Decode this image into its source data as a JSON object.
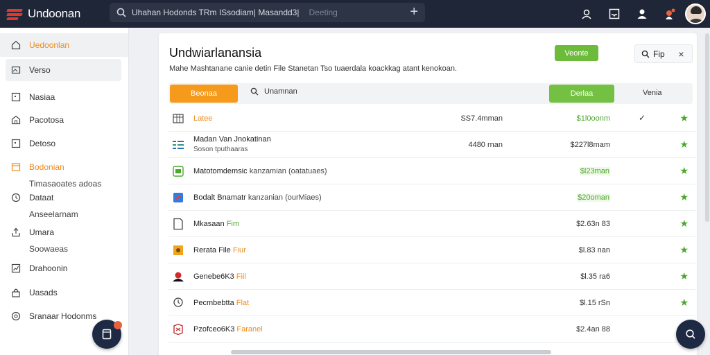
{
  "app": {
    "name": "Undoonan"
  },
  "search": {
    "text": "Uhahan Hodonds TRm ISsodiam| Masandd3| ",
    "placeholder": "Deeting"
  },
  "topbar_icons": [
    "user-icon",
    "inbox-icon",
    "account-icon",
    "notification-icon",
    "avatar"
  ],
  "sidebar": {
    "items": [
      {
        "label": "Uedoonlan",
        "icon": "home-icon",
        "state": "active"
      },
      {
        "label": "Verso",
        "icon": "image-icon",
        "state": "highlight"
      },
      {
        "label": "Nasiaa",
        "icon": "square-icon"
      },
      {
        "label": "Pacotosa",
        "icon": "house-icon"
      },
      {
        "label": "Detoso",
        "icon": "square-icon"
      },
      {
        "label": "Bodonian",
        "sub": "Timasaoates adoas",
        "icon": "folder-icon",
        "state": "orange"
      },
      {
        "label": "Dataat",
        "sub": "Anseelarnam",
        "icon": "clock-icon"
      },
      {
        "label": "Umara",
        "sub": "Soowaeas",
        "icon": "export-icon"
      },
      {
        "label": "Drahoonin",
        "icon": "chart-icon"
      },
      {
        "label": "Uasads",
        "icon": "lock-icon"
      },
      {
        "label": "Sranaar Hodonms",
        "icon": "settings-icon"
      }
    ]
  },
  "panel": {
    "title": "Undwiarlanansia",
    "description": "Mahe Mashtanane canie detin File  Stanetan Tso tuaerdala koackkag atant kenokoan.",
    "green_button": "Veonte",
    "flip_button": "Fip",
    "close_symbol": "×"
  },
  "toolbar": {
    "orange_button": "Beonaa",
    "search_label": "Unamnan",
    "green_button": "Derlaa",
    "view_label": "Venia"
  },
  "colors": {
    "orange": "#f59a1b",
    "green": "#6cbb3a",
    "navy": "#1f2637"
  },
  "rows": [
    {
      "icon": "grid-icon",
      "name": "Latee",
      "name_style": "orange",
      "size": "SS7.4mman",
      "price": "$1l0oonm",
      "price_style": "green",
      "check": "✓",
      "star": "★"
    },
    {
      "icon": "table-icon",
      "name": "Madan Van Jnokatinan",
      "sub": "Soson tputhaaras",
      "size": "4480 rnan",
      "price": "$227l8mam",
      "price_style": "plain",
      "star": "★"
    },
    {
      "icon": "spreadsheet-icon",
      "name": "Matotomdemsic",
      "muted": "kanzamian (oatatuaes)",
      "price": "$l23man",
      "price_style": "green-bg",
      "star": "★"
    },
    {
      "icon": "doc-icon",
      "name": "Bodalt Bnamatr",
      "muted": "kanzanian (ourMiaes)",
      "price": "$20oman",
      "price_style": "green-bg",
      "star": "★"
    },
    {
      "icon": "file-icon",
      "name": "Mkasaan",
      "tag": "Fim",
      "tag_style": "green",
      "price": "$2.63n 83",
      "price_style": "plain",
      "star": "★"
    },
    {
      "icon": "package-icon",
      "name": "Rerata File",
      "tag": "Fiur",
      "tag_style": "orange",
      "price": "$l.83 nan",
      "price_style": "plain",
      "star": "★"
    },
    {
      "icon": "record-icon",
      "name": "Genebe6K3",
      "tag": "Fiil",
      "tag_style": "orange",
      "price": "$l.35 ra6",
      "price_style": "plain",
      "star": "★"
    },
    {
      "icon": "pin-icon",
      "name": "Pecmbebtta",
      "tag": "Flat",
      "tag_style": "orange",
      "price": "$l.15 rSn",
      "price_style": "plain",
      "star": "★"
    },
    {
      "icon": "archive-icon",
      "name": "Pzofceo6K3",
      "tag": "Faranel",
      "tag_style": "orange",
      "price": "$2.4an 88",
      "price_style": "plain",
      "star": "★"
    }
  ]
}
